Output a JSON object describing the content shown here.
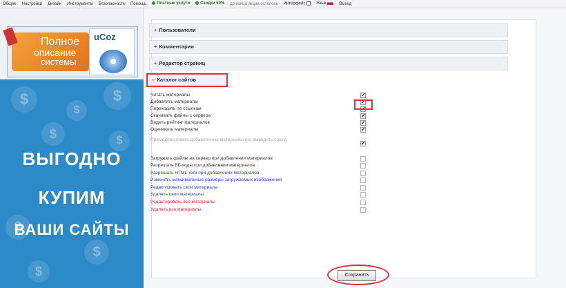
{
  "topbar": {
    "items": [
      {
        "label": "Общее",
        "style": "normal"
      },
      {
        "label": "Настройки",
        "style": "normal"
      },
      {
        "label": "Дизайн",
        "style": "normal"
      },
      {
        "label": "Инструменты",
        "style": "normal"
      },
      {
        "label": "Безопасность",
        "style": "normal"
      },
      {
        "label": "Помощь",
        "style": "normal"
      },
      {
        "label": "Платные услуги",
        "style": "green"
      },
      {
        "label": "Скидки 50%",
        "style": "green"
      },
      {
        "label": "до конца акции осталось",
        "style": "gray"
      },
      {
        "label": "Интерфейс",
        "style": "normal"
      },
      {
        "label": "Язык",
        "style": "normal"
      },
      {
        "label": "Выход",
        "style": "normal"
      }
    ]
  },
  "promo": {
    "line1": "Полное",
    "line2": "описание",
    "line3": "системы",
    "brand": "uCoz"
  },
  "ad": {
    "line1": "ВЫГОДНО",
    "line2": "КУПИМ",
    "line3": "ВАШИ САЙТЫ",
    "coin_symbol": "$",
    "bg_color": "#2d8ac9"
  },
  "sections": [
    {
      "label": "Пользователи",
      "prefix": "+"
    },
    {
      "label": "Комментарии",
      "prefix": "+"
    },
    {
      "label": "Редактор страниц",
      "prefix": "+"
    },
    {
      "label": "Каталог сайтов",
      "prefix": "–"
    }
  ],
  "permissions": [
    {
      "label": "Читать материалы",
      "checked": true,
      "color": "normal"
    },
    {
      "label": "Добавлять материалы",
      "checked": true,
      "color": "normal"
    },
    {
      "label": "Переходить по ссылкам",
      "checked": true,
      "color": "normal"
    },
    {
      "label": "Скачивать файлы с сервера",
      "checked": true,
      "color": "normal"
    },
    {
      "label": "Видеть рейтинг материалов",
      "checked": true,
      "color": "normal"
    },
    {
      "label": "Оценивать материалы",
      "checked": true,
      "color": "normal"
    },
    {
      "label": "Премодерировать добавленные материалы (не выводить сразу)",
      "checked": true,
      "color": "disabled"
    },
    {
      "label": "Загружать файлы на сервер при добавлении материалов",
      "checked": false,
      "color": "normal"
    },
    {
      "label": "Разрешать ББ-коды при добавлении материалов",
      "checked": false,
      "color": "normal"
    },
    {
      "label": "Разрешать HTML теги при добавлении материалов",
      "checked": false,
      "color": "blue"
    },
    {
      "label": "Изменять максимальные размеры загружаемых изображений",
      "checked": false,
      "color": "blue"
    },
    {
      "label": "Редактировать свои материалы",
      "checked": false,
      "color": "blue"
    },
    {
      "label": "Удалять свои материалы",
      "checked": false,
      "color": "blue"
    },
    {
      "label": "Редактировать все материалы",
      "checked": false,
      "color": "red"
    },
    {
      "label": "Удалять все материалы",
      "checked": false,
      "color": "red"
    }
  ],
  "save_label": "Сохранить",
  "colors": {
    "highlight": "#e4303a",
    "link_blue": "#2a3fcf",
    "danger_red": "#e42233"
  }
}
